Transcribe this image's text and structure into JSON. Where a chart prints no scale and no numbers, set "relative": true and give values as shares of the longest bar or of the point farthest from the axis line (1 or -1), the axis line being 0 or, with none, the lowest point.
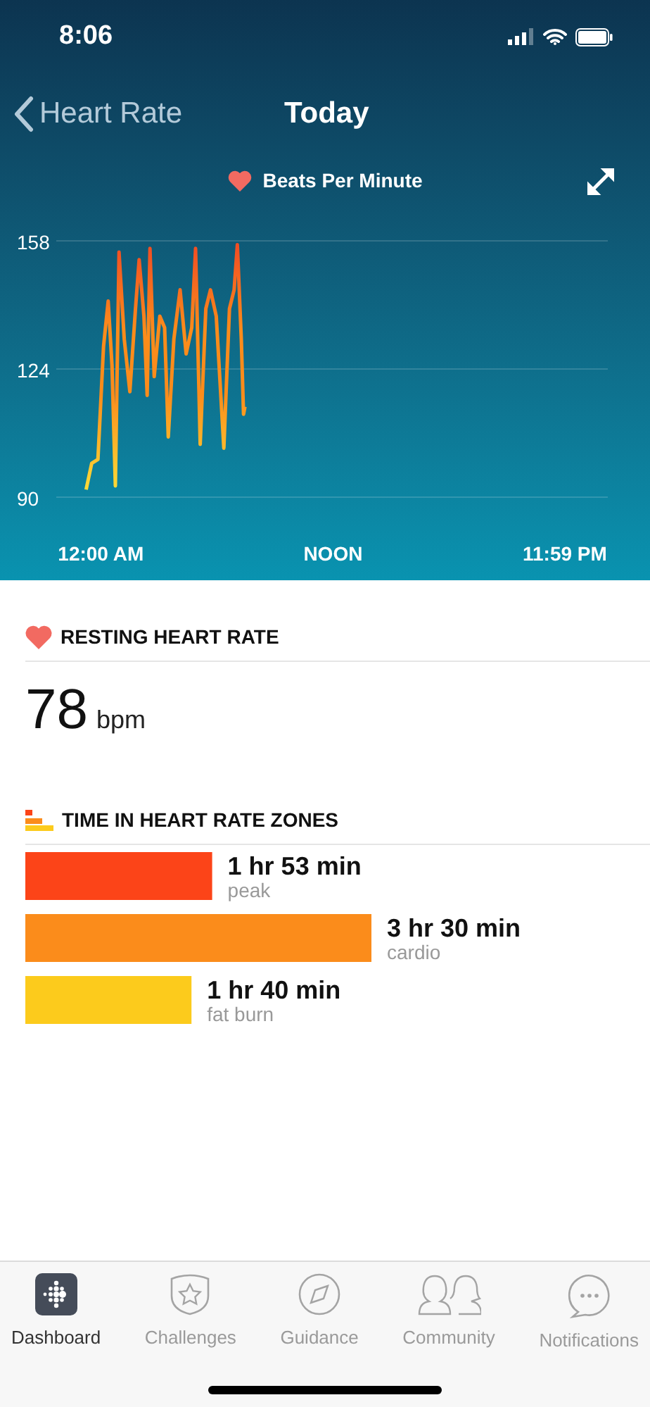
{
  "status_bar": {
    "time": "8:06"
  },
  "nav": {
    "back_label": "Heart Rate",
    "title": "Today"
  },
  "chart": {
    "chart_data": {
      "type": "line",
      "xlim": [
        -2.3,
        26.2
      ],
      "ylim": [
        90,
        158
      ],
      "yticks": [
        90,
        124,
        158
      ],
      "xticks": [
        {
          "value": 0,
          "label": "12:00 AM"
        },
        {
          "value": 12,
          "label": "NOON"
        },
        {
          "value": 23.98,
          "label": "11:59 PM"
        }
      ],
      "x": [
        -0.76,
        -0.47,
        -0.15,
        0.14,
        0.38,
        0.58,
        0.75,
        0.94,
        1.21,
        1.5,
        1.79,
        1.98,
        2.23,
        2.4,
        2.54,
        2.76,
        3.05,
        3.3,
        3.49,
        3.78,
        4.1,
        4.41,
        4.7,
        4.9,
        5.14,
        5.43,
        5.67,
        5.97,
        6.36,
        6.65,
        6.89,
        7.06,
        7.26,
        7.38,
        7.45
      ],
      "series": [
        {
          "name": "Beats Per Minute",
          "color": "#fb8c1b",
          "values": [
            92,
            99,
            100,
            130,
            142,
            125,
            93,
            155,
            132,
            118,
            140,
            153,
            138,
            117,
            156,
            122,
            138,
            135,
            106,
            132,
            145,
            128,
            135,
            156,
            104,
            140,
            145,
            138,
            103,
            140,
            145,
            157,
            132,
            112,
            114
          ]
        }
      ]
    }
  },
  "resting": {
    "heading": "RESTING HEART RATE",
    "value": "78",
    "unit": "bpm"
  },
  "zones": {
    "heading": "TIME IN HEART RATE ZONES",
    "items": [
      {
        "duration": "1 hr 53 min",
        "color": "#fc4418"
      },
      {
        "duration": "3 hr 30 min",
        "color": "#fb8c1b"
      },
      {
        "duration": "1 hr 40 min",
        "color": "#fccb1c"
      }
    ],
    "chart_data": {
      "type": "bar",
      "orientation": "horizontal",
      "relative": true,
      "categories": [
        "peak",
        "cardio",
        "fat burn"
      ],
      "values": [
        0.54,
        1,
        0.48
      ]
    }
  },
  "tabs": [
    {
      "label": "Dashboard",
      "kind": "dashboard",
      "selected": true
    },
    {
      "label": "Challenges",
      "kind": "challenges",
      "selected": false
    },
    {
      "label": "Guidance",
      "kind": "guidance",
      "selected": false
    },
    {
      "label": "Community",
      "kind": "community",
      "selected": false
    },
    {
      "label": "Notifications",
      "kind": "notifications",
      "selected": false
    }
  ]
}
